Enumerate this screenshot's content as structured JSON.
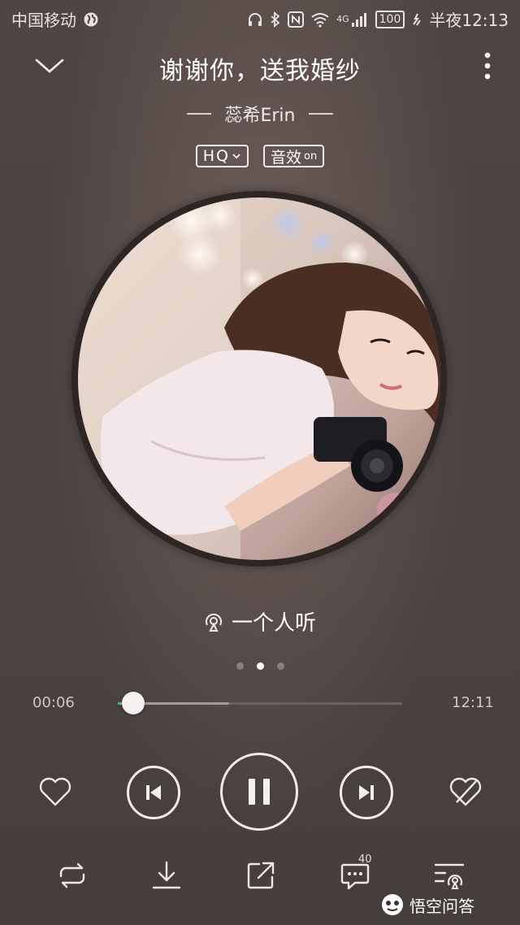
{
  "status_bar": {
    "carrier": "中国移动",
    "network": "4G",
    "battery": "100",
    "time": "半夜12:13"
  },
  "header": {
    "title": "谢谢你，送我婚纱",
    "artist": "蕊希Erin",
    "quality_badge": "HQ",
    "effect_badge": "音效",
    "effect_state": "on"
  },
  "listen_together": {
    "label": "一个人听"
  },
  "pager": {
    "count": 3,
    "active_index": 1
  },
  "progress": {
    "elapsed": "00:06",
    "duration": "12:11",
    "played_fraction": 0.008,
    "buffered_fraction": 0.39
  },
  "controls": {
    "like_icon": "heart-icon",
    "prev_icon": "previous-icon",
    "play_state_icon": "pause-icon",
    "next_icon": "next-icon",
    "dislike_icon": "heart-broken-icon"
  },
  "bottom_bar": {
    "comment_count": "40",
    "icons": [
      "repeat-icon",
      "download-icon",
      "share-icon",
      "comment-icon",
      "playlist-icon"
    ]
  },
  "watermark": {
    "text": "悟空问答"
  },
  "colors": {
    "accent": "#31c27c",
    "background": "#4b4241"
  }
}
